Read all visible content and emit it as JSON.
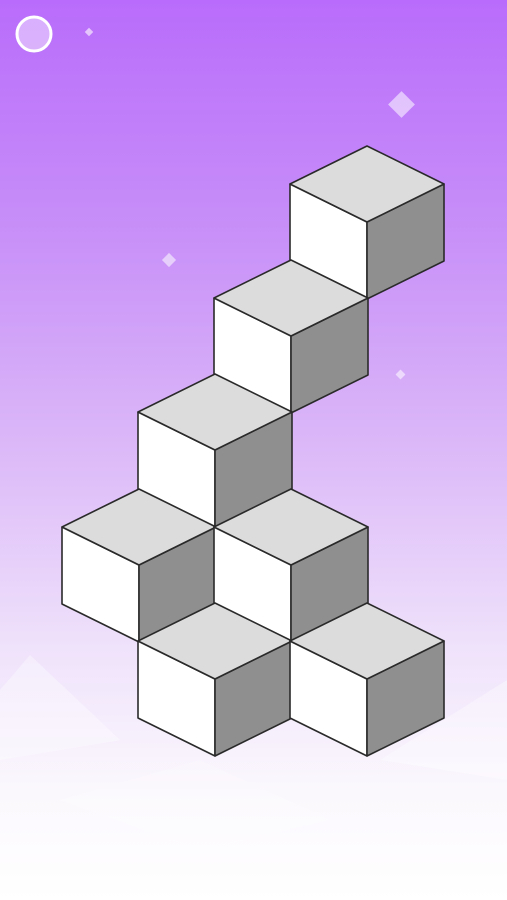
{
  "game": {
    "scene": "isometric-cube-puzzle",
    "background_gradient": [
      "#b96cfb",
      "#dcb9f8",
      "#ffffff"
    ],
    "cube_colors": {
      "top": "#dcdcdc",
      "left": "#ffffff",
      "right": "#8f8f8f",
      "stroke": "#2a2a2a"
    },
    "cubes": [
      {
        "id": "cube-1",
        "col": 0,
        "row": 0
      },
      {
        "id": "cube-2",
        "col": 1,
        "row": 0
      },
      {
        "id": "cube-3",
        "col": 1,
        "row": 1
      },
      {
        "id": "cube-4",
        "col": 2,
        "row": 1
      },
      {
        "id": "cube-5",
        "col": 2,
        "row": 2
      },
      {
        "id": "cube-6",
        "col": 3,
        "row": 3
      },
      {
        "id": "cube-7",
        "col": 4,
        "row": 4
      },
      {
        "id": "cube-8",
        "col": 1,
        "row": 2
      }
    ],
    "pause_button_icon": "circle-icon"
  }
}
